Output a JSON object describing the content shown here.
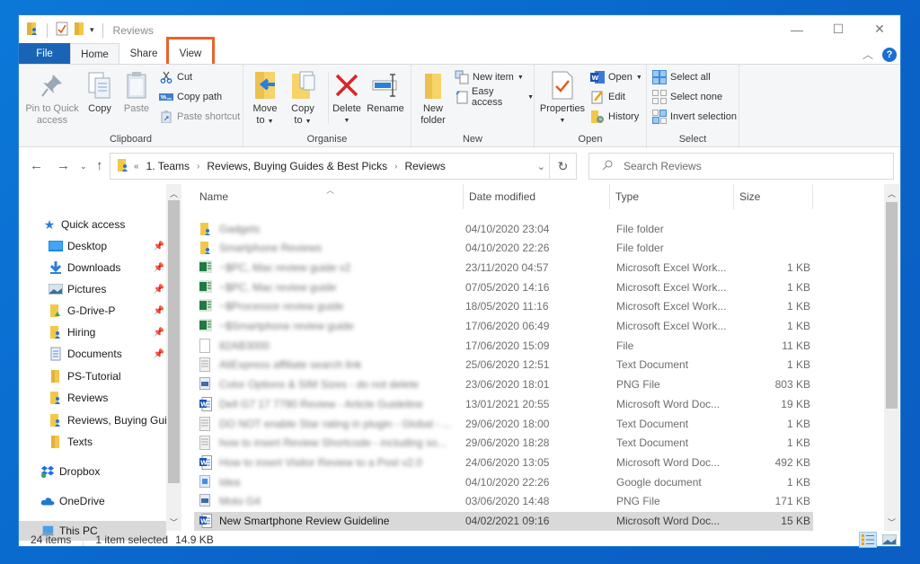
{
  "window": {
    "title": "Reviews",
    "controls": {
      "minimize": "—",
      "maximize": "☐",
      "close": "✕"
    }
  },
  "ribbon": {
    "tabs": [
      {
        "label": "File"
      },
      {
        "label": "Home"
      },
      {
        "label": "Share"
      },
      {
        "label": "View"
      }
    ],
    "highlight_color": "#e8622a",
    "groups": {
      "clipboard": {
        "label": "Clipboard",
        "pin_label_1": "Pin to Quick",
        "pin_label_2": "access",
        "copy": "Copy",
        "paste": "Paste",
        "cut": "Cut",
        "copy_path": "Copy path",
        "paste_shortcut": "Paste shortcut"
      },
      "organise": {
        "label": "Organise",
        "move_to_1": "Move",
        "move_to_2": "to",
        "copy_to_1": "Copy",
        "copy_to_2": "to",
        "delete": "Delete",
        "rename": "Rename"
      },
      "new": {
        "label": "New",
        "new_folder_1": "New",
        "new_folder_2": "folder",
        "new_item": "New item",
        "easy_access": "Easy access"
      },
      "open": {
        "label": "Open",
        "properties": "Properties",
        "open": "Open",
        "edit": "Edit",
        "history": "History"
      },
      "select": {
        "label": "Select",
        "select_all": "Select all",
        "select_none": "Select none",
        "invert_selection": "Invert selection"
      }
    }
  },
  "address": {
    "overflow": "«",
    "crumbs": [
      "1. Teams",
      "Reviews, Buying Guides & Best Picks",
      "Reviews"
    ],
    "search_placeholder": "Search Reviews"
  },
  "navpane": {
    "quick_access": "Quick access",
    "items": [
      {
        "label": "Desktop",
        "pinned": true
      },
      {
        "label": "Downloads",
        "pinned": true
      },
      {
        "label": "Pictures",
        "pinned": true
      },
      {
        "label": "G-Drive-P",
        "pinned": true
      },
      {
        "label": "Hiring",
        "pinned": true
      },
      {
        "label": "Documents",
        "pinned": true
      },
      {
        "label": "PS-Tutorial",
        "pinned": false
      },
      {
        "label": "Reviews",
        "pinned": false
      },
      {
        "label": "Reviews, Buying Guides & Best Picks",
        "pinned": false
      },
      {
        "label": "Texts",
        "pinned": false
      }
    ],
    "dropbox": "Dropbox",
    "onedrive": "OneDrive",
    "this_pc": "This PC"
  },
  "columns": {
    "name": "Name",
    "date": "Date modified",
    "type": "Type",
    "size": "Size"
  },
  "files": [
    {
      "name": "Gadgets",
      "date": "04/10/2020 23:04",
      "type": "File folder",
      "size": "",
      "icon": "folder-shared",
      "blurred": true
    },
    {
      "name": "Smartphone Reviews",
      "date": "04/10/2020 22:26",
      "type": "File folder",
      "size": "",
      "icon": "folder-shared",
      "blurred": true
    },
    {
      "name": "~$PC, Mac review guide v2",
      "date": "23/11/2020 04:57",
      "type": "Microsoft Excel Work...",
      "size": "1 KB",
      "icon": "excel",
      "blurred": true
    },
    {
      "name": "~$PC, Mac review guide",
      "date": "07/05/2020 14:16",
      "type": "Microsoft Excel Work...",
      "size": "1 KB",
      "icon": "excel",
      "blurred": true
    },
    {
      "name": "~$Processor review guide",
      "date": "18/05/2020 11:16",
      "type": "Microsoft Excel Work...",
      "size": "1 KB",
      "icon": "excel",
      "blurred": true
    },
    {
      "name": "~$Smartphone review guide",
      "date": "17/06/2020 06:49",
      "type": "Microsoft Excel Work...",
      "size": "1 KB",
      "icon": "excel",
      "blurred": true
    },
    {
      "name": "82AB3000",
      "date": "17/06/2020 15:09",
      "type": "File",
      "size": "11 KB",
      "icon": "file",
      "blurred": true
    },
    {
      "name": "AliExpress affiliate search link",
      "date": "25/06/2020 12:51",
      "type": "Text Document",
      "size": "1 KB",
      "icon": "text",
      "blurred": true
    },
    {
      "name": "Color Options & SIM Sizes - do not delete",
      "date": "23/06/2020 18:01",
      "type": "PNG File",
      "size": "803 KB",
      "icon": "png",
      "blurred": true
    },
    {
      "name": "Dell G7 17 7790 Review - Article Guideline",
      "date": "13/01/2021 20:55",
      "type": "Microsoft Word Doc...",
      "size": "19 KB",
      "icon": "word",
      "blurred": true
    },
    {
      "name": "DO NOT enable Star rating in plugin - Global - ...",
      "date": "29/06/2020 18:00",
      "type": "Text Document",
      "size": "1 KB",
      "icon": "text",
      "blurred": true
    },
    {
      "name": "how to insert Review Shortcode - including so...",
      "date": "29/06/2020 18:28",
      "type": "Text Document",
      "size": "1 KB",
      "icon": "text",
      "blurred": true
    },
    {
      "name": "How to insert Visitor Review to a Post v2.0",
      "date": "24/06/2020 13:05",
      "type": "Microsoft Word Doc...",
      "size": "492 KB",
      "icon": "word",
      "blurred": true
    },
    {
      "name": "Idea",
      "date": "04/10/2020 22:26",
      "type": "Google document",
      "size": "1 KB",
      "icon": "gdoc",
      "blurred": true
    },
    {
      "name": "Moto G4",
      "date": "03/06/2020 14:48",
      "type": "PNG File",
      "size": "171 KB",
      "icon": "png",
      "blurred": true
    },
    {
      "name": "New Smartphone Review Guideline",
      "date": "04/02/2021 09:16",
      "type": "Microsoft Word Doc...",
      "size": "15 KB",
      "icon": "word",
      "blurred": false,
      "selected": true
    }
  ],
  "status": {
    "item_count": "24 items",
    "selection": "1 item selected",
    "selection_size": "14.9 KB"
  }
}
